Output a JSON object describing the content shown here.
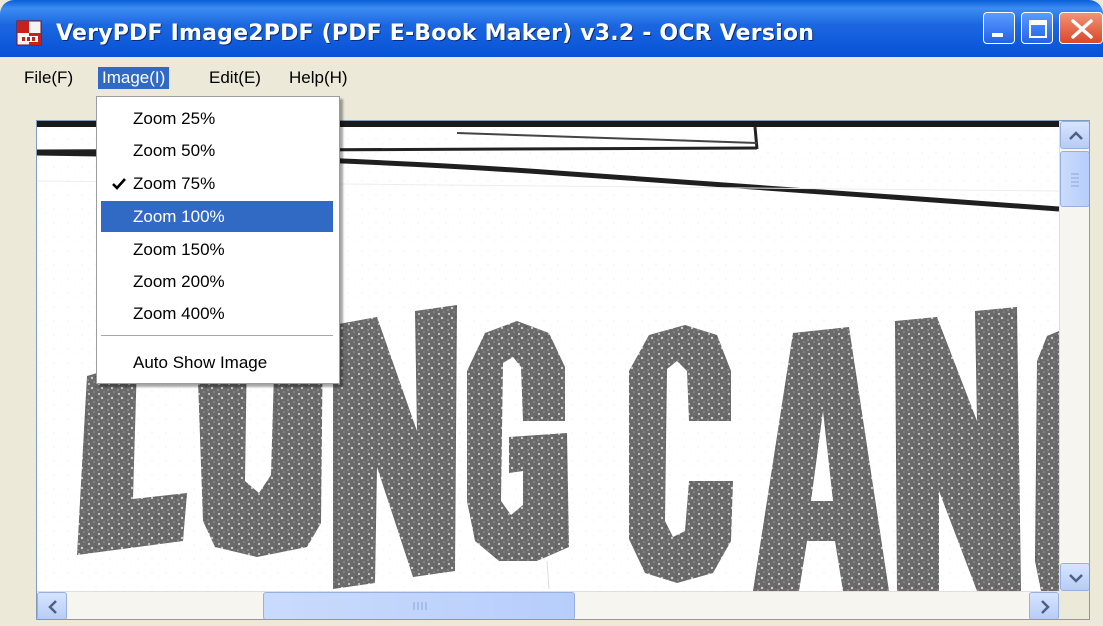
{
  "window": {
    "title": "VeryPDF Image2PDF (PDF E-Book Maker) v3.2 - OCR Version",
    "app_icon": "pdf-app-icon",
    "controls": [
      "minimize",
      "maximize",
      "close"
    ]
  },
  "menubar": {
    "items": [
      {
        "label": "File(F)"
      },
      {
        "label": "Image(I)",
        "active": true
      },
      {
        "label": "Edit(E)"
      },
      {
        "label": "Help(H)"
      }
    ]
  },
  "image_menu": {
    "items": [
      {
        "label": "Zoom 25%",
        "checked": false,
        "highlighted": false
      },
      {
        "label": "Zoom 50%",
        "checked": false,
        "highlighted": false
      },
      {
        "label": "Zoom 75%",
        "checked": true,
        "highlighted": false
      },
      {
        "label": "Zoom 100%",
        "checked": false,
        "highlighted": true
      },
      {
        "label": "Zoom 150%",
        "checked": false,
        "highlighted": false
      },
      {
        "label": "Zoom 200%",
        "checked": false,
        "highlighted": false
      },
      {
        "label": "Zoom 400%",
        "checked": false,
        "highlighted": false
      }
    ],
    "auto_show": "Auto Show Image"
  },
  "document": {
    "visible_text": "LUNG CANC"
  },
  "colors": {
    "titlebar": "#0651d6",
    "menu_highlight": "#316ac5",
    "window_bg": "#ece9d8",
    "close_button": "#d9482a"
  }
}
